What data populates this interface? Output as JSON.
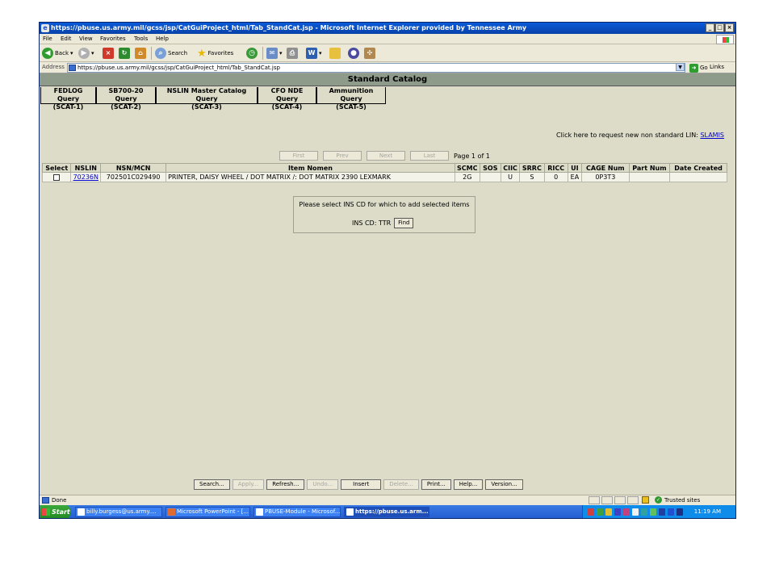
{
  "browser": {
    "title": "https://pbuse.us.army.mil/gcss/jsp/CatGuiProject_html/Tab_StandCat.jsp - Microsoft Internet Explorer provided by Tennessee Army",
    "menu": [
      "File",
      "Edit",
      "View",
      "Favorites",
      "Tools",
      "Help"
    ],
    "toolbar": {
      "back": "Back",
      "search": "Search",
      "favorites": "Favorites"
    },
    "address_label": "Address",
    "address": "https://pbuse.us.army.mil/gcss/jsp/CatGuiProject_html/Tab_StandCat.jsp",
    "go": "Go",
    "links": "Links"
  },
  "page": {
    "header": "Standard Catalog",
    "tabs": [
      {
        "line1": "FEDLOG Query",
        "line2": "(SCAT-1)"
      },
      {
        "line1": "SB700-20 Query",
        "line2": "(SCAT-2)"
      },
      {
        "line1": "NSLIN Master Catalog Query",
        "line2": "(SCAT-3)"
      },
      {
        "line1": "CFO NDE Query",
        "line2": "(SCAT-4)"
      },
      {
        "line1": "Ammunition Query",
        "line2": "(SCAT-5)"
      }
    ],
    "request_text": "Click here to request new non standard LIN:",
    "request_link": "SLAMIS",
    "pager": {
      "first": "First",
      "prev": "Prev",
      "next": "Next",
      "last": "Last",
      "info": "Page 1 of 1"
    },
    "table": {
      "headers": [
        "Select",
        "NSLIN",
        "NSN/MCN",
        "Item Nomen",
        "SCMC",
        "SOS",
        "CIIC",
        "SRRC",
        "RICC",
        "UI",
        "CAGE Num",
        "Part Num",
        "Date Created"
      ],
      "row": {
        "nslin": "70236N",
        "nsn": "702501C029490",
        "nomen": "PRINTER, DAISY WHEEL / DOT MATRIX /: DOT MATRIX 2390 LEXMARK",
        "scmc": "2G",
        "sos": "",
        "ciic": "U",
        "srrc": "S",
        "ricc": "0",
        "ui": "EA",
        "cage": "0P3T3",
        "part": "",
        "date": ""
      }
    },
    "ins": {
      "prompt": "Please select INS CD for which to add selected items",
      "label": "INS CD: TTR",
      "find": "Find"
    },
    "buttons": {
      "search": "Search...",
      "apply": "Apply...",
      "refresh": "Refresh...",
      "undo": "Undo...",
      "insert": "Insert",
      "delete": "Delete...",
      "print": "Print...",
      "help": "Help...",
      "version": "Version..."
    }
  },
  "status": {
    "text": "Done",
    "zone": "Trusted sites"
  },
  "taskbar": {
    "start": "Start",
    "tasks": [
      "billy.burgess@us.army....",
      "Microsoft PowerPoint - [...",
      "PBUSE-Module - Microsof...",
      "https://pbuse.us.arm..."
    ],
    "clock": "11:19 AM"
  }
}
